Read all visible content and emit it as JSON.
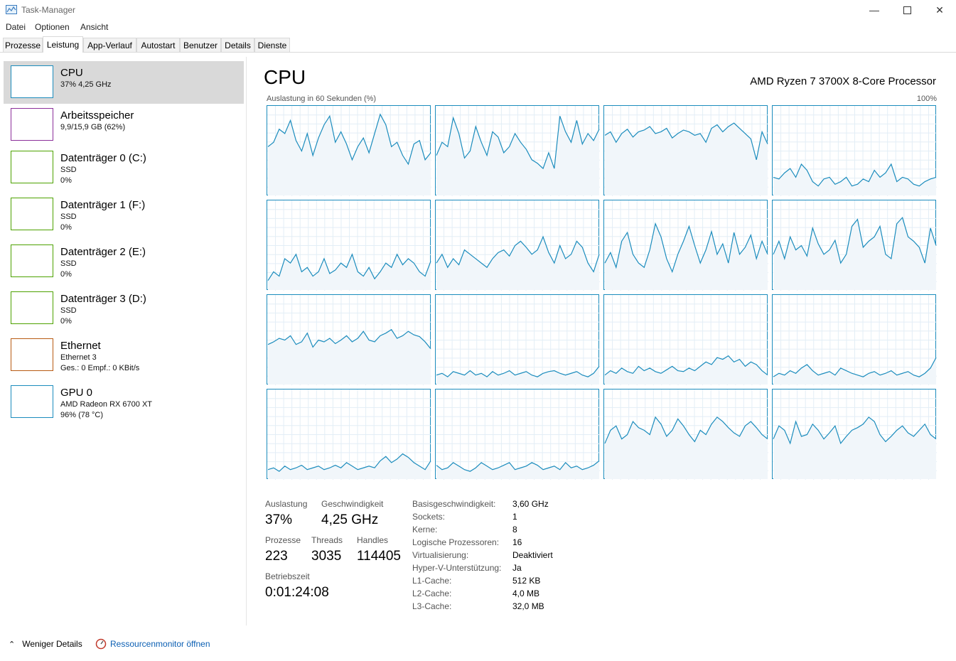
{
  "window": {
    "title": "Task-Manager"
  },
  "menu": [
    "Datei",
    "Optionen",
    "Ansicht"
  ],
  "tabs": [
    "Prozesse",
    "Leistung",
    "App-Verlauf",
    "Autostart",
    "Benutzer",
    "Details",
    "Dienste"
  ],
  "active_tab": "Leistung",
  "sidebar": [
    {
      "title": "CPU",
      "sub1": "37% 4,25 GHz",
      "sub2": "",
      "color": "#1b8cbd",
      "selected": true
    },
    {
      "title": "Arbeitsspeicher",
      "sub1": "9,9/15,9 GB (62%)",
      "sub2": "",
      "color": "#8b2f9a",
      "selected": false
    },
    {
      "title": "Datenträger 0 (C:)",
      "sub1": "SSD",
      "sub2": "0%",
      "color": "#4da200",
      "selected": false
    },
    {
      "title": "Datenträger 1 (F:)",
      "sub1": "SSD",
      "sub2": "0%",
      "color": "#4da200",
      "selected": false
    },
    {
      "title": "Datenträger 2 (E:)",
      "sub1": "SSD",
      "sub2": "0%",
      "color": "#4da200",
      "selected": false
    },
    {
      "title": "Datenträger 3 (D:)",
      "sub1": "SSD",
      "sub2": "0%",
      "color": "#4da200",
      "selected": false
    },
    {
      "title": "Ethernet",
      "sub1": "Ethernet 3",
      "sub2": "Ges.: 0 Empf.: 0 KBit/s",
      "color": "#b85a12",
      "selected": false
    },
    {
      "title": "GPU 0",
      "sub1": "AMD Radeon RX 6700 XT",
      "sub2": "96% (78 °C)",
      "color": "#1b8cbd",
      "selected": false
    }
  ],
  "main": {
    "title": "CPU",
    "model": "AMD Ryzen 7 3700X 8-Core Processor",
    "util_label": "Auslastung in 60 Sekunden (%)",
    "util_max": "100%",
    "graph_color": "#1b8cbd",
    "graph_fill": "#f1f6fa"
  },
  "stats": {
    "auslastung_label": "Auslastung",
    "auslastung": "37%",
    "geschw_label": "Geschwindigkeit",
    "geschw": "4,25 GHz",
    "prozesse_label": "Prozesse",
    "prozesse": "223",
    "threads_label": "Threads",
    "threads": "3035",
    "handles_label": "Handles",
    "handles": "114405",
    "betrieb_label": "Betriebszeit",
    "betrieb": "0:01:24:08"
  },
  "info": [
    {
      "key": "Basisgeschwindigkeit:",
      "val": "3,60 GHz"
    },
    {
      "key": "Sockets:",
      "val": "1"
    },
    {
      "key": "Kerne:",
      "val": "8"
    },
    {
      "key": "Logische Prozessoren:",
      "val": "16"
    },
    {
      "key": "Virtualisierung:",
      "val": "Deaktiviert"
    },
    {
      "key": "Hyper-V-Unterstützung:",
      "val": "Ja"
    },
    {
      "key": "L1-Cache:",
      "val": "512 KB"
    },
    {
      "key": "L2-Cache:",
      "val": "4,0 MB"
    },
    {
      "key": "L3-Cache:",
      "val": "32,0 MB"
    }
  ],
  "footer": {
    "fewer": "Weniger Details",
    "resmon": "Ressourcenmonitor öffnen"
  },
  "core_levels": [
    [
      55,
      60,
      75,
      70,
      85,
      62,
      50,
      70,
      45,
      65,
      80,
      90,
      60,
      72,
      58,
      40,
      55,
      65,
      48,
      70,
      92,
      80,
      55,
      60,
      45,
      35,
      58,
      62,
      40,
      48
    ],
    [
      45,
      60,
      55,
      88,
      70,
      42,
      50,
      78,
      60,
      45,
      72,
      66,
      48,
      55,
      70,
      60,
      52,
      40,
      36,
      30,
      48,
      30,
      90,
      72,
      60,
      85,
      58,
      70,
      62,
      75
    ],
    [
      68,
      72,
      60,
      70,
      75,
      66,
      72,
      74,
      78,
      70,
      72,
      76,
      65,
      70,
      74,
      72,
      68,
      70,
      60,
      76,
      80,
      72,
      78,
      82,
      76,
      70,
      64,
      40,
      72,
      58
    ],
    [
      20,
      18,
      25,
      30,
      20,
      35,
      28,
      15,
      10,
      18,
      20,
      12,
      15,
      20,
      10,
      12,
      18,
      15,
      28,
      20,
      25,
      35,
      15,
      20,
      18,
      12,
      10,
      15,
      18,
      20
    ],
    [
      10,
      20,
      15,
      35,
      30,
      40,
      20,
      25,
      15,
      20,
      35,
      18,
      22,
      30,
      25,
      40,
      20,
      15,
      25,
      12,
      20,
      30,
      25,
      40,
      28,
      35,
      30,
      20,
      15,
      32
    ],
    [
      30,
      40,
      25,
      35,
      28,
      45,
      40,
      35,
      30,
      25,
      35,
      42,
      45,
      38,
      50,
      55,
      48,
      40,
      45,
      60,
      42,
      30,
      50,
      35,
      40,
      55,
      48,
      30,
      20,
      40
    ],
    [
      30,
      42,
      25,
      55,
      65,
      40,
      30,
      25,
      45,
      75,
      60,
      35,
      20,
      40,
      55,
      72,
      50,
      30,
      45,
      66,
      40,
      52,
      30,
      65,
      40,
      48,
      62,
      35,
      55,
      40
    ],
    [
      40,
      55,
      35,
      60,
      45,
      50,
      38,
      70,
      52,
      40,
      45,
      56,
      30,
      40,
      72,
      80,
      48,
      55,
      60,
      72,
      40,
      35,
      75,
      82,
      60,
      55,
      48,
      30,
      70,
      50
    ],
    [
      45,
      48,
      52,
      50,
      55,
      45,
      48,
      58,
      42,
      50,
      48,
      52,
      46,
      50,
      55,
      48,
      52,
      60,
      50,
      48,
      55,
      58,
      62,
      52,
      55,
      60,
      56,
      54,
      48,
      40
    ],
    [
      10,
      12,
      8,
      14,
      12,
      10,
      15,
      10,
      12,
      8,
      14,
      10,
      12,
      15,
      10,
      12,
      14,
      10,
      8,
      12,
      14,
      15,
      12,
      10,
      12,
      14,
      10,
      8,
      12,
      20
    ],
    [
      10,
      15,
      12,
      18,
      14,
      12,
      20,
      15,
      18,
      14,
      12,
      16,
      20,
      15,
      14,
      18,
      15,
      20,
      25,
      22,
      30,
      28,
      32,
      25,
      28,
      20,
      25,
      22,
      15,
      10
    ],
    [
      8,
      12,
      10,
      15,
      12,
      18,
      22,
      15,
      10,
      12,
      14,
      10,
      18,
      15,
      12,
      10,
      8,
      12,
      14,
      10,
      12,
      15,
      10,
      12,
      14,
      10,
      8,
      12,
      18,
      30
    ],
    [
      10,
      12,
      8,
      14,
      10,
      12,
      15,
      10,
      12,
      14,
      10,
      12,
      15,
      12,
      18,
      14,
      10,
      12,
      14,
      12,
      20,
      25,
      18,
      22,
      28,
      24,
      18,
      14,
      10,
      20
    ],
    [
      15,
      10,
      12,
      18,
      14,
      10,
      8,
      12,
      18,
      14,
      10,
      12,
      15,
      18,
      10,
      12,
      14,
      18,
      15,
      10,
      12,
      14,
      10,
      18,
      12,
      14,
      10,
      12,
      15,
      20
    ],
    [
      40,
      55,
      60,
      45,
      50,
      65,
      58,
      55,
      50,
      70,
      62,
      48,
      55,
      68,
      60,
      50,
      42,
      55,
      50,
      62,
      70,
      65,
      58,
      52,
      48,
      60,
      65,
      58,
      50,
      45
    ],
    [
      45,
      60,
      55,
      40,
      65,
      48,
      50,
      62,
      55,
      45,
      52,
      60,
      40,
      48,
      55,
      58,
      62,
      70,
      65,
      50,
      42,
      48,
      55,
      60,
      52,
      48,
      55,
      62,
      50,
      45
    ]
  ]
}
